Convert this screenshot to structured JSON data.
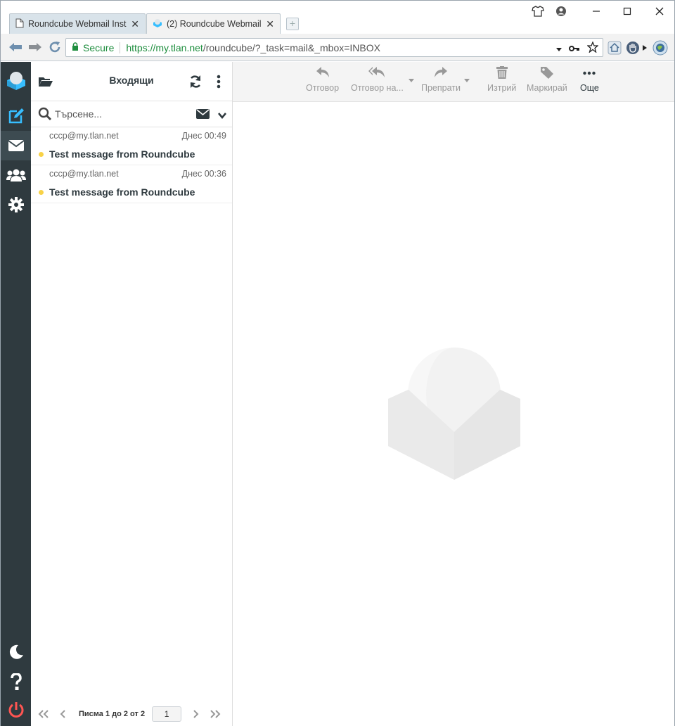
{
  "browser": {
    "tabs": [
      {
        "title": "Roundcube Webmail Inst"
      },
      {
        "title": "(2) Roundcube Webmail"
      }
    ],
    "secure_label": "Secure",
    "url_host": "https://my.tlan.net",
    "url_rest": "/roundcube/?_task=mail&_mbox=INBOX"
  },
  "list": {
    "title": "Входящи",
    "search_placeholder": "Търсене...",
    "messages": [
      {
        "from": "cccp@my.tlan.net",
        "date": "Днес 00:49",
        "subject": "Test message from Roundcube"
      },
      {
        "from": "cccp@my.tlan.net",
        "date": "Днес 00:36",
        "subject": "Test message from Roundcube"
      }
    ],
    "pager_text": "Писма 1 до 2 от 2",
    "page_number": "1"
  },
  "toolbar": {
    "reply": "Отговор",
    "reply_all": "Отговор на...",
    "forward": "Препрати",
    "delete": "Изтрий",
    "mark": "Маркирай",
    "more": "Още"
  },
  "colors": {
    "taskbar": "#2f3a3f",
    "accent": "#37beff",
    "unread_dot": "#f8d247",
    "logout": "#ff5552"
  }
}
